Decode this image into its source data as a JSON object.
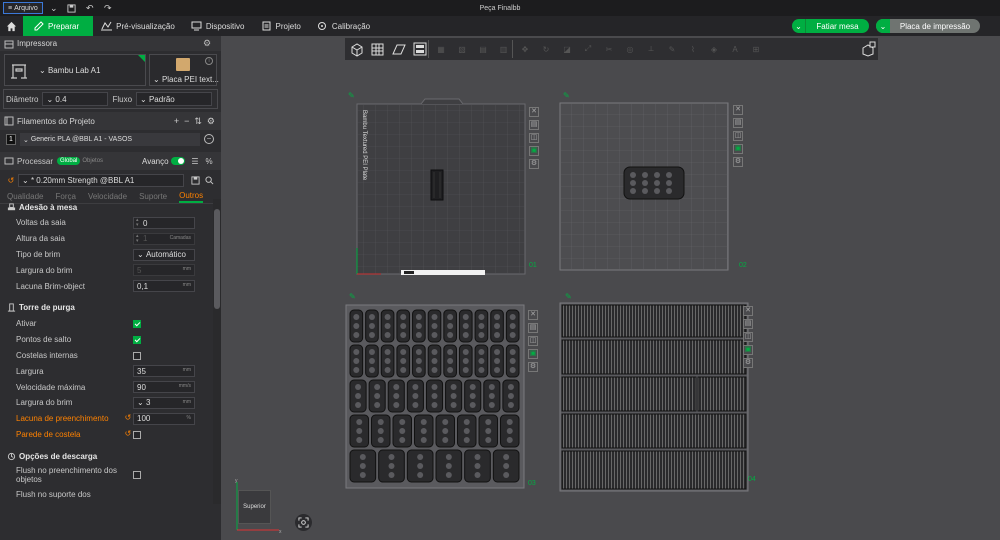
{
  "window": {
    "file_menu": "Arquivo",
    "title": "Peça Finalbb"
  },
  "menubar": {
    "prepare": "Preparar",
    "preview": "Pré-visualização",
    "device": "Dispositivo",
    "project": "Projeto",
    "calibration": "Calibração",
    "slice": "Fatiar mesa",
    "print": "Placa de impressão"
  },
  "printer": {
    "section": "Impressora",
    "name": "Bambu Lab A1",
    "plate": "Placa PEI text...",
    "diameter_label": "Diâmetro",
    "diameter_value": "0.4",
    "flow_label": "Fluxo",
    "flow_value": "Padrão"
  },
  "filaments": {
    "section": "Filamentos do Projeto",
    "slot": "1",
    "name": "Generic PLA @BBL A1 - VASOS"
  },
  "process": {
    "section": "Processar",
    "tag_global": "Global",
    "tag_objects": "Objetos",
    "advanced": "Avanço",
    "preset": "* 0.20mm Strength @BBL A1",
    "tabs": [
      "Qualidade",
      "Força",
      "Velocidade",
      "Suporte",
      "Outros"
    ],
    "active_tab": 4
  },
  "params": {
    "adhesion": {
      "title": "Adesão à mesa",
      "skirt_loops": {
        "label": "Voltas da saia",
        "value": "0"
      },
      "skirt_height": {
        "label": "Altura da saia",
        "value": "1",
        "unit": "Camadas"
      },
      "brim_type": {
        "label": "Tipo de brim",
        "value": "Automático"
      },
      "brim_width": {
        "label": "Largura do brim",
        "value": "5",
        "unit": "mm"
      },
      "brim_gap": {
        "label": "Lacuna Brim-object",
        "value": "0,1",
        "unit": "mm"
      }
    },
    "prime_tower": {
      "title": "Torre de purga",
      "enable": {
        "label": "Ativar",
        "checked": true
      },
      "skip_points": {
        "label": "Pontos de salto",
        "checked": true
      },
      "internal_ribs": {
        "label": "Costelas internas",
        "checked": false
      },
      "width": {
        "label": "Largura",
        "value": "35",
        "unit": "mm"
      },
      "max_speed": {
        "label": "Velocidade máxima",
        "value": "90",
        "unit": "mm/s"
      },
      "brim_width": {
        "label": "Largura do brim",
        "value": "3",
        "unit": "mm"
      },
      "infill_gap": {
        "label": "Lacuna de preenchimento",
        "value": "100",
        "unit": "%"
      },
      "rib_wall": {
        "label": "Parede de costela",
        "checked": false
      }
    },
    "flush": {
      "title": "Opções de descarga",
      "flush_infill": {
        "label": "Flush no preenchimento dos objetos",
        "checked": false
      },
      "flush_support": {
        "label": "Flush no suporte dos"
      }
    }
  },
  "canvas": {
    "view_label": "Superior",
    "plate1_label": "Bambu Textured PEI Plate",
    "plate_numbers": [
      "01",
      "02",
      "03",
      "04"
    ]
  },
  "colors": {
    "accent": "#00ae42",
    "highlight": "#ff8200",
    "canvas_bg": "#4a4a4d",
    "panel_bg": "#2d2d30"
  }
}
